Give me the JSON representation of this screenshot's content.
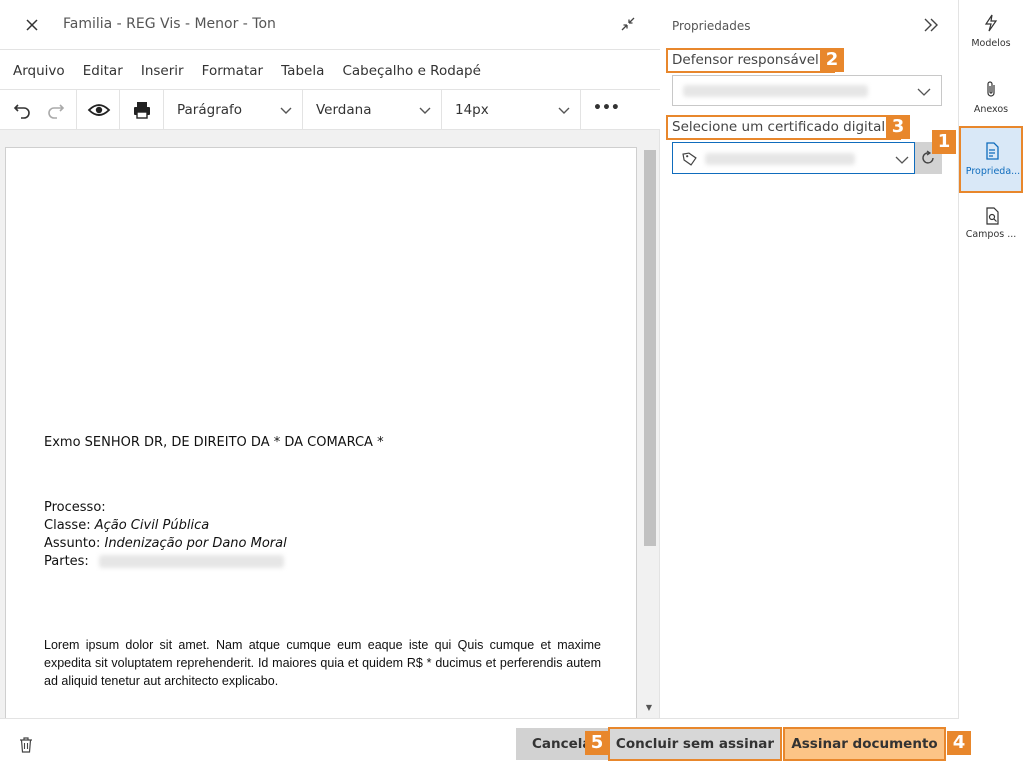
{
  "editor": {
    "title": "Familia - REG Vis - Menor - Ton",
    "menu": [
      "Arquivo",
      "Editar",
      "Inserir",
      "Formatar",
      "Tabela",
      "Cabeçalho e Rodapé"
    ],
    "toolbar": {
      "block_format": "Parágrafo",
      "font_family": "Verdana",
      "font_size": "14px",
      "more": "•••"
    }
  },
  "document": {
    "heading": "Exmo SENHOR DR, DE DIREITO DA * DA COMARCA *",
    "processo_label": "Processo:",
    "classe_label": "Classe: ",
    "classe_value": "Ação Civil Pública",
    "assunto_label": "Assunto: ",
    "assunto_value": "Indenização por Dano Moral",
    "partes_label": "Partes:",
    "body": "Lorem ipsum dolor sit amet.    Nam atque cumque eum eaque iste qui Quis cumque et maxime expedita sit voluptatem reprehenderit. Id maiores quia et quidem R$ * ducimus et perferendis autem ad aliquid tenetur aut architecto explicabo."
  },
  "properties": {
    "title": "Propriedades",
    "defensor_label": "Defensor responsável",
    "certificado_label": "Selecione um certificado digital",
    "required_mark": "*"
  },
  "rail": [
    {
      "label": "Modelos",
      "icon": "lightning-icon"
    },
    {
      "label": "Anexos",
      "icon": "paperclip-icon"
    },
    {
      "label": "Proprieda...",
      "icon": "document-properties-icon"
    },
    {
      "label": "Campos ...",
      "icon": "document-search-icon"
    }
  ],
  "footer": {
    "cancel": "Cancela",
    "conclude": "Concluir sem assinar",
    "sign": "Assinar documento"
  },
  "badges": [
    "1",
    "2",
    "3",
    "4",
    "5"
  ],
  "colors": {
    "accent_orange": "#e8872c",
    "primary_button": "#fcc486",
    "active_rail": "#d9e8f7",
    "link_blue": "#0f6cbd",
    "required_red": "#c4232f"
  }
}
